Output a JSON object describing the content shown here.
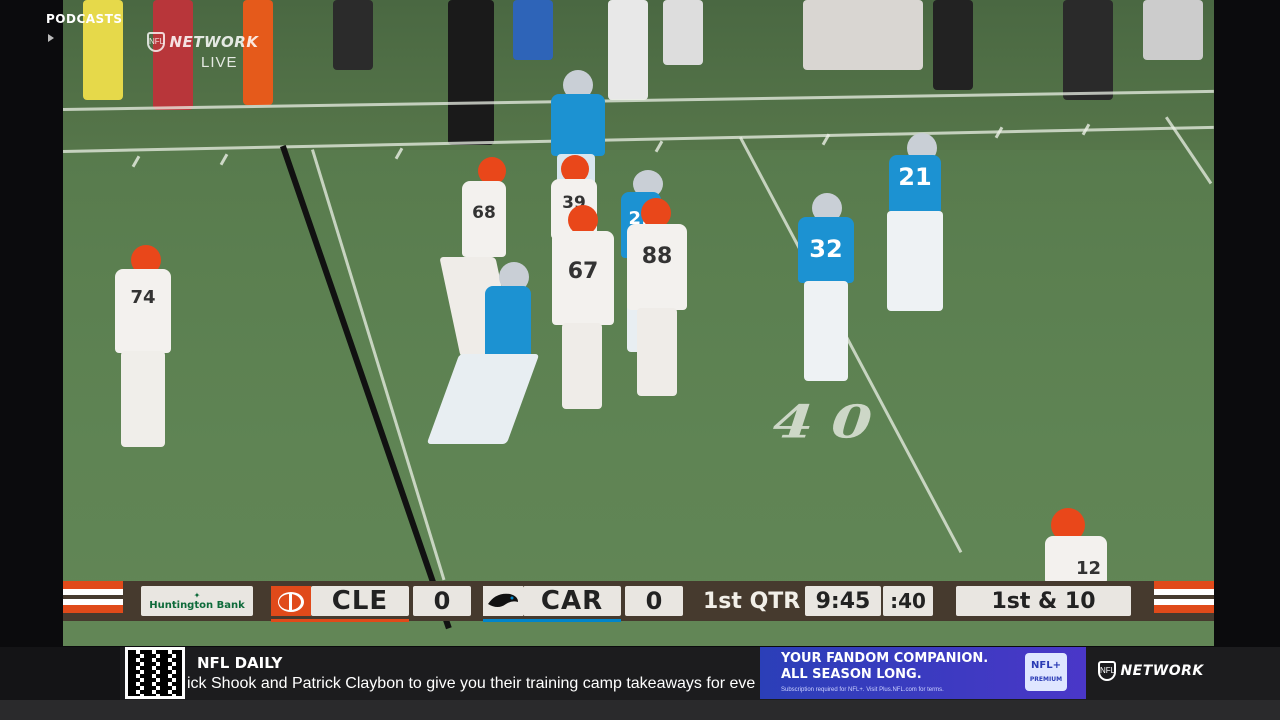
{
  "broadcast": {
    "network_name": "NETWORK",
    "live_label": "LIVE",
    "shield_text": "NFL"
  },
  "field": {
    "yard_number": "40"
  },
  "jerseys": [
    "74",
    "68",
    "39",
    "67",
    "88",
    "21",
    "32",
    "21",
    "12"
  ],
  "scoreboard": {
    "sponsor": "Huntington Bank",
    "away": {
      "abbr": "CLE",
      "score": "0",
      "color": "#e04a1a"
    },
    "home": {
      "abbr": "CAR",
      "score": "0",
      "color": "#0085ca"
    },
    "quarter": "1st QTR",
    "clock": "9:45",
    "play_clock": ":40",
    "down_distance": "1st & 10"
  },
  "ticker": {
    "section_label": "PODCASTS",
    "show_title": "NFL DAILY",
    "show_description": "ick Shook and Patrick Claybon to give you their training camp takeaways for eve",
    "ad_line1": "YOUR FANDOM COMPANION.",
    "ad_line2": "ALL SEASON LONG.",
    "ad_fineprint": "Subscription required for NFL+. Visit Plus.NFL.com for terms.",
    "ad_logo_text": "NFL+",
    "ad_logo_sub": "PREMIUM",
    "network_logo": "NETWORK"
  }
}
